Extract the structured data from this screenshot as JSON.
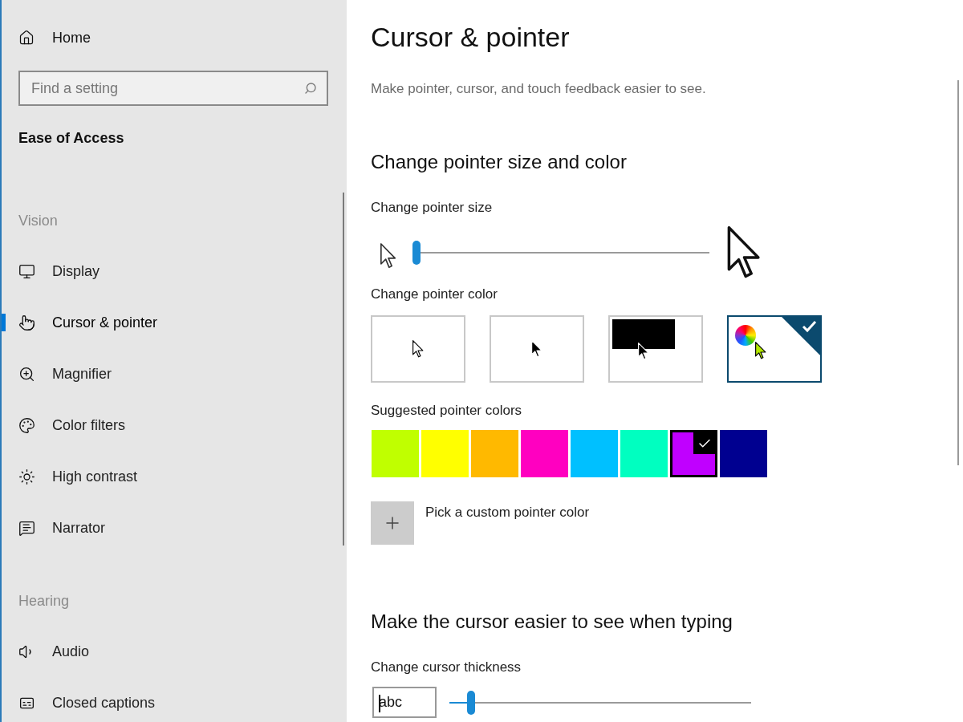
{
  "sidebar": {
    "home": "Home",
    "search": {
      "placeholder": "Find a setting"
    },
    "section_title": "Ease of Access",
    "groups": [
      {
        "heading": "Vision",
        "items": [
          {
            "label": "Display",
            "selected": false
          },
          {
            "label": "Cursor & pointer",
            "selected": true
          },
          {
            "label": "Magnifier",
            "selected": false
          },
          {
            "label": "Color filters",
            "selected": false
          },
          {
            "label": "High contrast",
            "selected": false
          },
          {
            "label": "Narrator",
            "selected": false
          }
        ]
      },
      {
        "heading": "Hearing",
        "items": [
          {
            "label": "Audio",
            "selected": false
          },
          {
            "label": "Closed captions",
            "selected": false
          }
        ]
      }
    ]
  },
  "page": {
    "title": "Cursor & pointer",
    "description": "Make pointer, cursor, and touch feedback easier to see.",
    "pointer_section": {
      "heading": "Change pointer size and color",
      "size_label": "Change pointer size",
      "size_slider": {
        "level": 0
      },
      "color_label": "Change pointer color",
      "color_options": [
        {
          "kind": "white",
          "selected": false
        },
        {
          "kind": "black",
          "selected": false
        },
        {
          "kind": "inverted",
          "selected": false
        },
        {
          "kind": "custom",
          "selected": true
        }
      ],
      "suggested_label": "Suggested pointer colors",
      "suggested_colors": [
        {
          "color": "#c0ff00",
          "selected": false
        },
        {
          "color": "#ffff00",
          "selected": false
        },
        {
          "color": "#ffb900",
          "selected": false
        },
        {
          "color": "#ff00c0",
          "selected": false
        },
        {
          "color": "#00c0ff",
          "selected": false
        },
        {
          "color": "#00ffc0",
          "selected": false
        },
        {
          "color": "#c000ff",
          "selected": true
        },
        {
          "color": "#000090",
          "selected": false
        }
      ],
      "custom_color": "Pick a custom pointer color"
    },
    "cursor_section": {
      "heading": "Make the cursor easier to see when typing",
      "thickness_label": "Change cursor thickness",
      "preview_value": "abc",
      "thickness_slider": {
        "level": 0.06
      }
    }
  }
}
